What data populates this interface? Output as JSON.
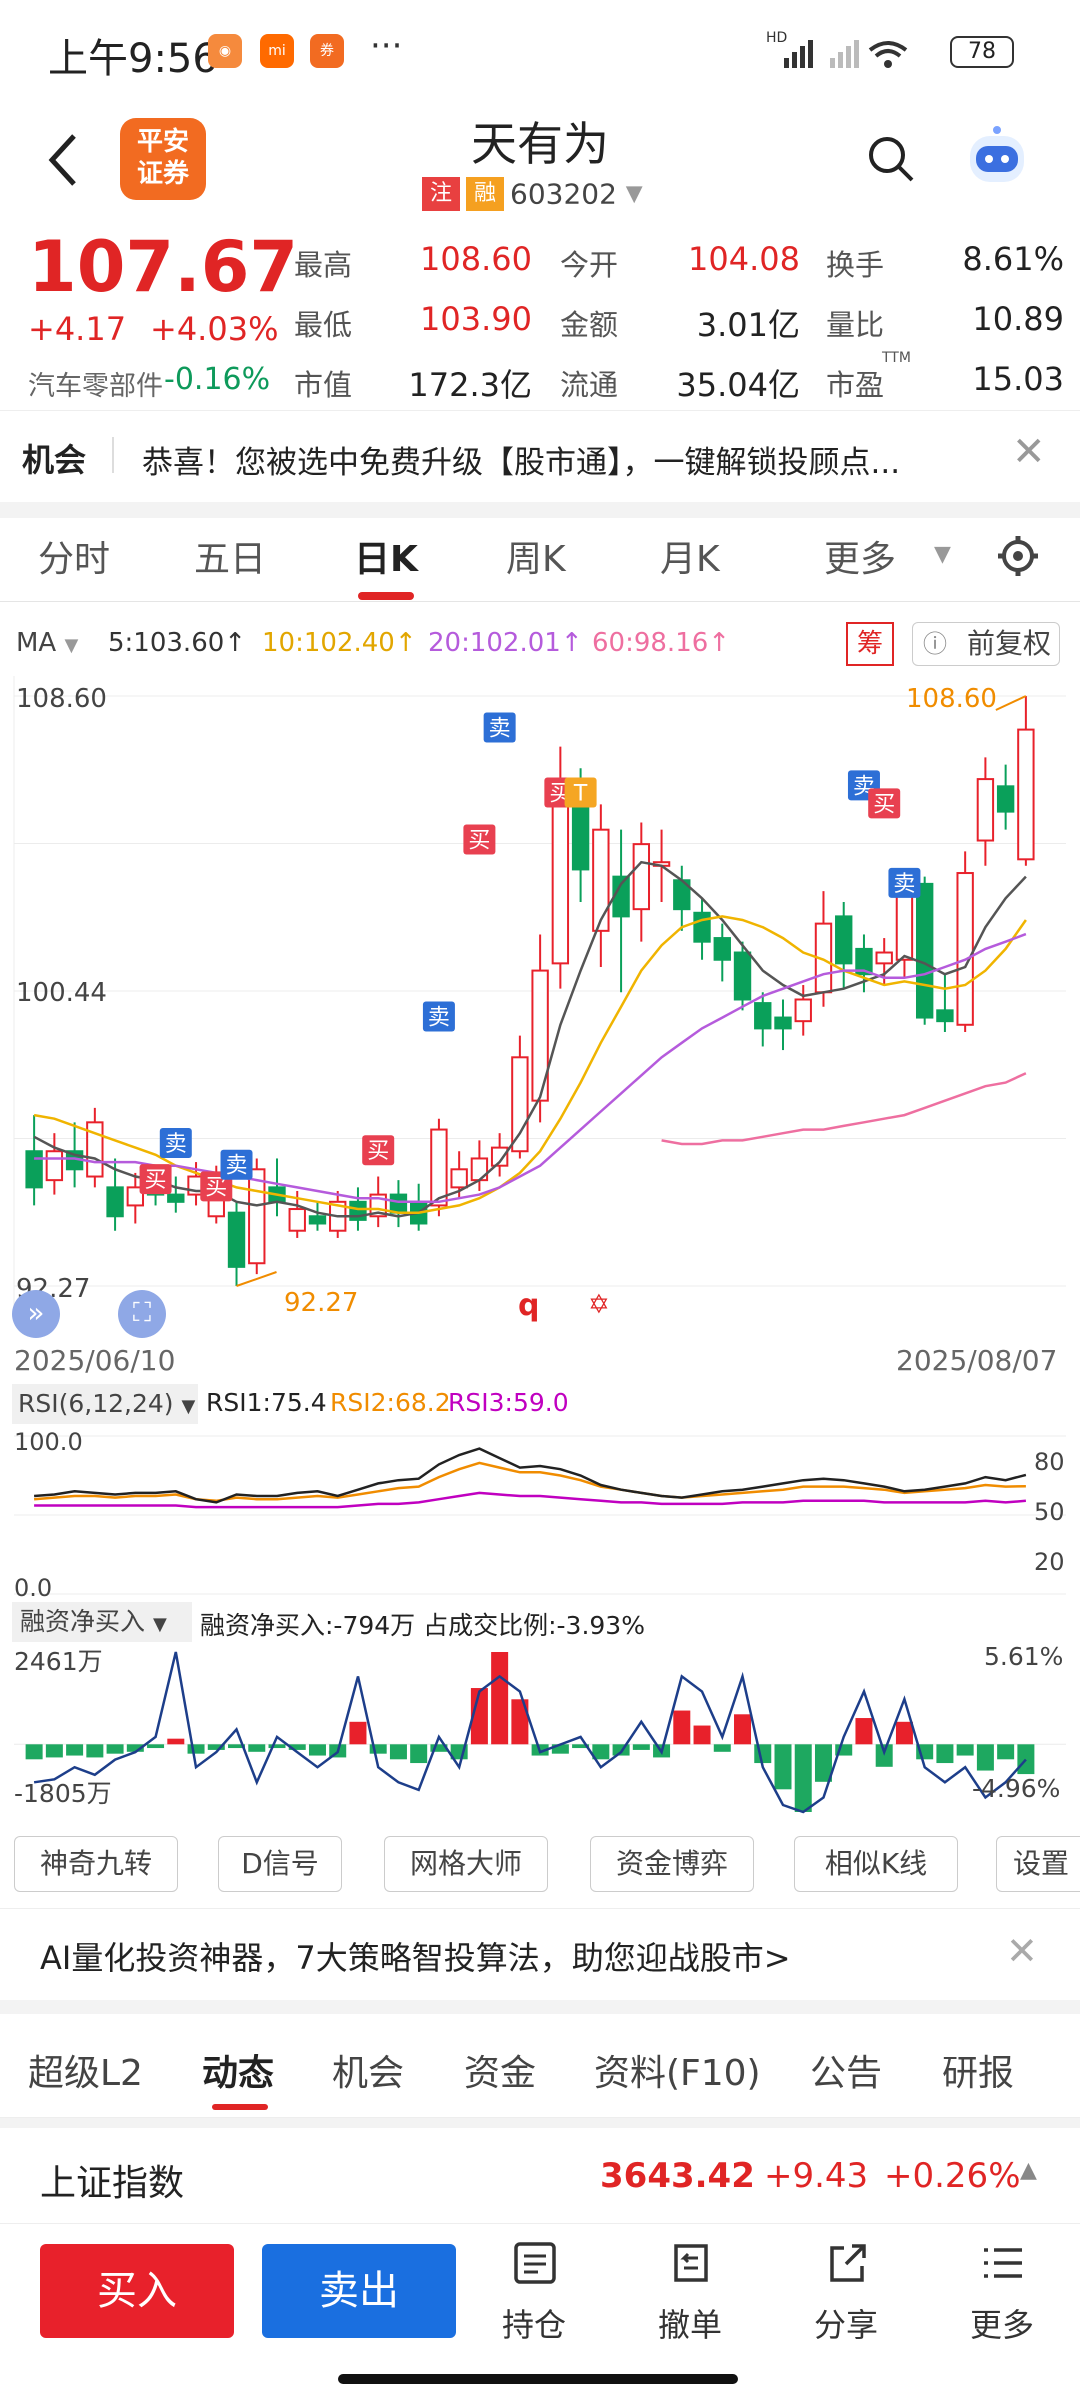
{
  "status_bar": {
    "time": "上午9:56",
    "battery": "78",
    "signal": "HD"
  },
  "header": {
    "broker_logo_line1": "平安",
    "broker_logo_line2": "证券",
    "stock_name": "天有为",
    "tag_zhu": "注",
    "tag_rong": "融",
    "stock_code": "603202"
  },
  "quote": {
    "price": "107.67",
    "change": "+4.17",
    "change_pct": "+4.03%",
    "sector": "汽车零部件",
    "sector_change": "-0.16%",
    "high_label": "最高",
    "high": "108.60",
    "open_label": "今开",
    "open": "104.08",
    "turnover_label": "换手",
    "turnover": "8.61%",
    "low_label": "最低",
    "low": "103.90",
    "amount_label": "金额",
    "amount": "3.01亿",
    "vol_ratio_label": "量比",
    "vol_ratio": "10.89",
    "mcap_label": "市值",
    "mcap": "172.3亿",
    "float_label": "流通",
    "float_cap": "35.04亿",
    "pe_label": "市盈",
    "pe_sup": "TTM",
    "pe": "15.03"
  },
  "notice": {
    "tag": "机会",
    "text": "恭喜！您被选中免费升级【股市通】，一键解锁投顾点..."
  },
  "chart_tabs": {
    "items": [
      "分时",
      "五日",
      "日K",
      "周K",
      "月K",
      "更多"
    ],
    "active": "日K"
  },
  "ma": {
    "label": "MA",
    "ma5": "5:103.60↑",
    "ma10": "10:102.40↑",
    "ma20": "20:102.01↑",
    "ma60": "60:98.16↑",
    "chip": "筹",
    "adjust": "前复权",
    "colors": {
      "ma5": "#555555",
      "ma10": "#f0b400",
      "ma20": "#b55bdc",
      "ma60": "#ee6fa0"
    }
  },
  "kline": {
    "y_top": "108.60",
    "y_mid": "100.44",
    "y_bottom": "92.27",
    "max_label": "108.60",
    "min_label": "92.27",
    "date_start": "2025/06/10",
    "date_end": "2025/08/07",
    "sig_buy": "买",
    "sig_sell": "卖",
    "sig_t": "T",
    "mark_q": "q"
  },
  "rsi": {
    "label": "RSI(6,12,24)",
    "rsi1": "RSI1:75.4",
    "rsi2": "RSI2:68.2",
    "rsi3": "RSI3:59.0",
    "y_top": "100.0",
    "y_bottom": "0.0",
    "r80": "80",
    "r50": "50",
    "r20": "20"
  },
  "margin": {
    "label": "融资净买入",
    "summary": "融资净买入:-794万 占成交比例:-3.93%",
    "left_top": "2461万",
    "left_bottom": "-1805万",
    "right_top": "5.61%",
    "right_bottom": "-4.96%"
  },
  "tools": [
    "神奇九转",
    "D信号",
    "网格大师",
    "资金博弈",
    "相似K线",
    "设置"
  ],
  "ad": {
    "text": "AI量化投资神器，7大策略智投算法，助您迎战股市>"
  },
  "section_tabs": {
    "items": [
      "超级L2",
      "动态",
      "机会",
      "资金",
      "资料(F10)",
      "公告",
      "研报"
    ],
    "active": "动态"
  },
  "index": {
    "name": "上证指数",
    "value": "3643.42",
    "change": "+9.43",
    "change_pct": "+0.26%"
  },
  "toolbar": {
    "buy": "买入",
    "sell": "卖出",
    "position": "持仓",
    "cancel": "撤单",
    "share": "分享",
    "more": "更多"
  },
  "chart_data": {
    "type": "candlestick",
    "x_range": [
      "2025/06/10",
      "2025/08/07"
    ],
    "ylim": [
      92.27,
      108.6
    ],
    "candles": [
      [
        96,
        95,
        97,
        94.5
      ],
      [
        95.2,
        96,
        96.5,
        94.8
      ],
      [
        96,
        95.5,
        96.8,
        95
      ],
      [
        95.3,
        96.8,
        97.2,
        95
      ],
      [
        95,
        94.2,
        95.8,
        93.8
      ],
      [
        94.5,
        95,
        95.4,
        94
      ],
      [
        95,
        94.8,
        95.6,
        94.5
      ],
      [
        94.8,
        94.6,
        95.3,
        94.3
      ],
      [
        94.8,
        95.3,
        95.7,
        94.5
      ],
      [
        94.2,
        94.9,
        95.6,
        94
      ],
      [
        94.3,
        92.8,
        94.6,
        92.27
      ],
      [
        92.9,
        95.5,
        95.8,
        92.6
      ],
      [
        95,
        94.6,
        95.8,
        94.2
      ],
      [
        93.8,
        94.4,
        94.9,
        93.6
      ],
      [
        94.2,
        94,
        94.6,
        93.8
      ],
      [
        93.8,
        94.6,
        94.9,
        93.6
      ],
      [
        94.6,
        94.1,
        95,
        93.8
      ],
      [
        94.2,
        94.8,
        95.3,
        93.9
      ],
      [
        94.8,
        94.3,
        95.2,
        93.9
      ],
      [
        94.6,
        94,
        95.1,
        93.8
      ],
      [
        94.5,
        96.6,
        96.9,
        94.2
      ],
      [
        95,
        95.5,
        96,
        94.7
      ],
      [
        95.2,
        95.8,
        96.3,
        94.9
      ],
      [
        95.6,
        96.1,
        96.5,
        95.3
      ],
      [
        96,
        98.6,
        99.2,
        95.8
      ],
      [
        97.4,
        101,
        102,
        96.8
      ],
      [
        101.2,
        106.2,
        107.2,
        100.5
      ],
      [
        105.8,
        103.8,
        106.6,
        102.9
      ],
      [
        102.1,
        104.9,
        105.6,
        101.1
      ],
      [
        103.6,
        102.5,
        104.9,
        100.4
      ],
      [
        102.7,
        104.5,
        105.1,
        101.8
      ],
      [
        103.9,
        104,
        104.9,
        102.9
      ],
      [
        103.5,
        102.7,
        103.9,
        102.1
      ],
      [
        102.6,
        101.8,
        103,
        101.3
      ],
      [
        101.9,
        101.3,
        102.3,
        100.7
      ],
      [
        101.5,
        100.2,
        101.8,
        99.9
      ],
      [
        100.1,
        99.4,
        100.4,
        98.9
      ],
      [
        99.7,
        99.4,
        100.2,
        98.8
      ],
      [
        99.6,
        100.2,
        100.6,
        99.2
      ],
      [
        100.4,
        102.3,
        103.2,
        100
      ],
      [
        102.5,
        101.2,
        102.9,
        100.5
      ],
      [
        101.6,
        100.9,
        102,
        100.4
      ],
      [
        101.2,
        101.5,
        101.9,
        100.6
      ],
      [
        101.3,
        103.4,
        103.7,
        100.8
      ],
      [
        103.4,
        99.7,
        103.6,
        99.5
      ],
      [
        99.9,
        99.6,
        100.9,
        99.3
      ],
      [
        99.5,
        103.7,
        104.3,
        99.3
      ],
      [
        104.6,
        106.3,
        106.9,
        103.9
      ],
      [
        106.1,
        105.4,
        106.7,
        104.9
      ],
      [
        104.08,
        107.67,
        108.6,
        103.9
      ]
    ],
    "ma5": [
      96.4,
      96.1,
      95.9,
      95.8,
      95.5,
      95.3,
      95.2,
      95,
      94.9,
      94.9,
      94.6,
      94.5,
      94.6,
      94.5,
      94.3,
      94.2,
      94.2,
      94.3,
      94.2,
      94.3,
      94.7,
      94.9,
      95.2,
      95.7,
      96.5,
      97.5,
      99.5,
      101,
      102.4,
      103.4,
      104,
      103.9,
      103.5,
      103,
      102.4,
      101.7,
      101,
      100.6,
      100.3,
      100.4,
      100.5,
      100.7,
      100.9,
      101.4,
      101.2,
      100.9,
      101.1,
      102.2,
      103,
      103.6
    ],
    "ma10": [
      97,
      96.9,
      96.7,
      96.5,
      96.3,
      96.1,
      95.9,
      95.6,
      95.4,
      95.2,
      95,
      94.9,
      94.8,
      94.7,
      94.6,
      94.5,
      94.4,
      94.4,
      94.3,
      94.3,
      94.4,
      94.5,
      94.7,
      95,
      95.4,
      96,
      96.9,
      97.9,
      99,
      100,
      101,
      101.7,
      102.2,
      102.4,
      102.5,
      102.4,
      102.2,
      101.9,
      101.5,
      101.3,
      101,
      100.8,
      100.6,
      100.7,
      100.6,
      100.5,
      100.6,
      101,
      101.6,
      102.4
    ],
    "ma20": [
      95.8,
      95.8,
      95.8,
      95.7,
      95.7,
      95.7,
      95.6,
      95.6,
      95.5,
      95.4,
      95.3,
      95.2,
      95.1,
      95,
      94.9,
      94.8,
      94.7,
      94.7,
      94.6,
      94.6,
      94.6,
      94.7,
      94.8,
      95,
      95.3,
      95.6,
      96.1,
      96.6,
      97.1,
      97.6,
      98.1,
      98.6,
      99,
      99.4,
      99.7,
      100,
      100.3,
      100.5,
      100.7,
      100.9,
      101,
      101,
      100.8,
      100.8,
      100.9,
      101.1,
      101.3,
      101.6,
      101.8,
      102.01
    ],
    "ma60_start_index": 31,
    "ma60": [
      96.3,
      96.2,
      96.2,
      96.3,
      96.3,
      96.4,
      96.5,
      96.6,
      96.6,
      96.7,
      96.8,
      96.9,
      97,
      97.2,
      97.4,
      97.6,
      97.8,
      97.9,
      98.16
    ],
    "rsi1": [
      62,
      63,
      65,
      64,
      63,
      64,
      64,
      65,
      60,
      58,
      63,
      62,
      62,
      64,
      65,
      62,
      66,
      70,
      72,
      73,
      82,
      88,
      92,
      86,
      80,
      81,
      79,
      75,
      69,
      66,
      64,
      62,
      61,
      63,
      65,
      66,
      68,
      70,
      72,
      73,
      72,
      70,
      68,
      65,
      66,
      68,
      70,
      74,
      72,
      75.4
    ],
    "rsi2": [
      60,
      61,
      62,
      62,
      61,
      62,
      62,
      63,
      60,
      59,
      61,
      60,
      60,
      61,
      62,
      61,
      63,
      65,
      67,
      68,
      74,
      79,
      83,
      80,
      77,
      77,
      75,
      72,
      68,
      66,
      64,
      62,
      61,
      62,
      63,
      64,
      65,
      66,
      68,
      68,
      68,
      67,
      66,
      64,
      65,
      66,
      67,
      69,
      68,
      68.2
    ],
    "rsi3": [
      56,
      56,
      56,
      56,
      56,
      56,
      56,
      56,
      55,
      55,
      55,
      55,
      55,
      55,
      55,
      55,
      56,
      57,
      57,
      58,
      60,
      62,
      64,
      63,
      62,
      62,
      61,
      60,
      59,
      58,
      58,
      57,
      57,
      57,
      57,
      58,
      58,
      58,
      59,
      59,
      59,
      59,
      58,
      58,
      58,
      58,
      58,
      59,
      58,
      59
    ],
    "margin_net_buy_wan": [
      -400,
      -350,
      -300,
      -350,
      -250,
      -200,
      -100,
      150,
      -250,
      -150,
      -100,
      -200,
      -100,
      -150,
      -300,
      -350,
      600,
      -250,
      -400,
      -500,
      -200,
      -400,
      1500,
      2461,
      1200,
      -300,
      -250,
      -100,
      -400,
      -300,
      -150,
      -350,
      900,
      500,
      -200,
      800,
      -500,
      -1200,
      -1805,
      -1000,
      -300,
      700,
      -600,
      600,
      -400,
      -500,
      -300,
      -700,
      -400,
      -794
    ],
    "margin_ratio_pct": [
      -3,
      -2.8,
      -2,
      -2.5,
      -1.5,
      -1,
      0,
      5.61,
      -2,
      -1,
      0.5,
      -3,
      0,
      -1,
      -2,
      -1,
      4,
      -2,
      -3,
      -3.5,
      0,
      -2,
      3,
      4,
      3,
      -1,
      -0.5,
      0,
      -2,
      -1,
      1,
      -1,
      4,
      3,
      0,
      4,
      -2,
      -4.5,
      -4.96,
      -4,
      0,
      3,
      -1,
      2.5,
      -2,
      -3,
      -2,
      -4,
      -3,
      -1.5
    ]
  }
}
